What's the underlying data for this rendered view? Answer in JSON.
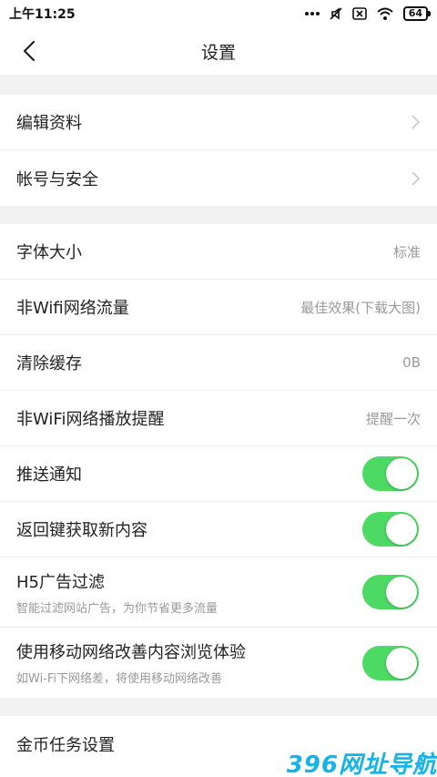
{
  "status_bar": {
    "time": "上午11:25",
    "icons": [
      "more-dots-icon",
      "mute-icon",
      "close-box-icon",
      "wifi-icon"
    ],
    "battery": "64"
  },
  "header": {
    "title": "设置",
    "back_icon": "chevron-left-icon"
  },
  "groups": {
    "account": [
      {
        "label": "编辑资料"
      },
      {
        "label": "帐号与安全"
      }
    ],
    "settings": [
      {
        "label": "字体大小",
        "value": "标准"
      },
      {
        "label": "非Wifi网络流量",
        "value": "最佳效果(下载大图)"
      },
      {
        "label": "清除缓存",
        "value": "0B"
      },
      {
        "label": "非WiFi网络播放提醒",
        "value": "提醒一次"
      },
      {
        "label": "推送通知",
        "toggle": true
      },
      {
        "label": "返回键获取新内容",
        "toggle": true
      },
      {
        "label": "H5广告过滤",
        "sub": "智能过滤网站广告，为你节省更多流量",
        "toggle": true
      },
      {
        "label": "使用移动网络改善内容浏览体验",
        "sub": "如Wi-Fi下网络差，将使用移动网络改善",
        "toggle": true
      }
    ],
    "coins": [
      {
        "label": "金币任务设置"
      }
    ]
  },
  "colors": {
    "toggle_on": "#4cd964",
    "section_bg": "#f2f2f2"
  },
  "watermark": "396网址导航"
}
